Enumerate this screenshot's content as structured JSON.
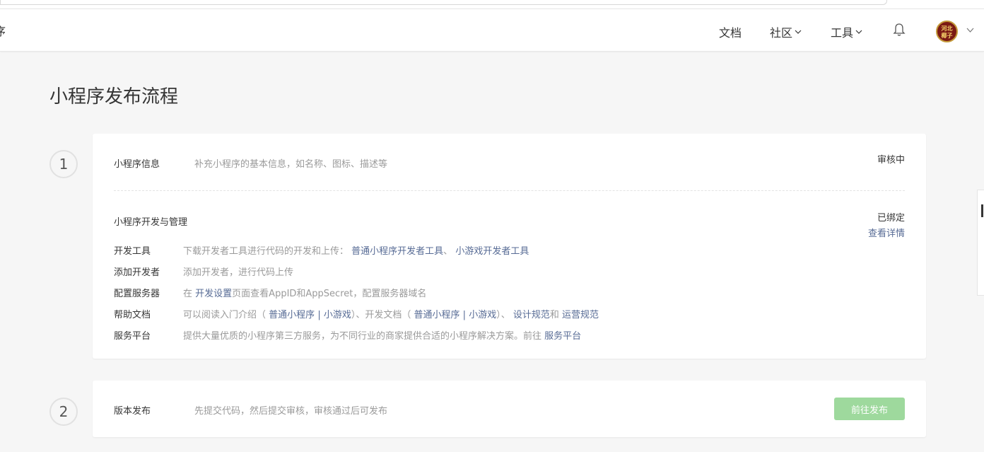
{
  "nav": {
    "logo_fragment": "序",
    "docs": "文档",
    "community": "社区",
    "tools": "工具",
    "avatar_text": "河北\n椰子"
  },
  "page_title": "小程序发布流程",
  "step1": {
    "number": "1",
    "info_label": "小程序信息",
    "info_desc": "补充小程序的基本信息，如名称、图标、描述等",
    "info_status": "审核中",
    "dev_label": "小程序开发与管理",
    "dev_status": "已绑定",
    "dev_detail_link": "查看详情",
    "rows": [
      {
        "key": "开发工具",
        "text1": "下载开发者工具进行代码的开发和上传：",
        "link1": "普通小程序开发者工具",
        "sep1": "、",
        "link2": "小游戏开发者工具"
      },
      {
        "key": "添加开发者",
        "text1": "添加开发者，进行代码上传"
      },
      {
        "key": "配置服务器",
        "text1": "在",
        "link1": "开发设置",
        "text2": "页面查看AppID和AppSecret，配置服务器域名"
      },
      {
        "key": "帮助文档",
        "text1": "可以阅读入门介绍（",
        "link1": "普通小程序",
        "sep1": "|",
        "link2": "小游戏",
        "text2": "）、开发文档（",
        "link3": "普通小程序",
        "sep2": "|",
        "link4": "小游戏",
        "text3": "）、",
        "link5": "设计规范",
        "text4": "和",
        "link6": "运营规范"
      },
      {
        "key": "服务平台",
        "text1": "提供大量优质的小程序第三方服务，为不同行业的商家提供合适的小程序解决方案。前往",
        "link1": "服务平台"
      }
    ]
  },
  "step2": {
    "number": "2",
    "label": "版本发布",
    "desc": "先提交代码，然后提交审核，审核通过后可发布",
    "button": "前往发布"
  },
  "colors": {
    "link": "#576b95",
    "button_disabled": "#9ed99d",
    "background": "#f6f6f6"
  }
}
